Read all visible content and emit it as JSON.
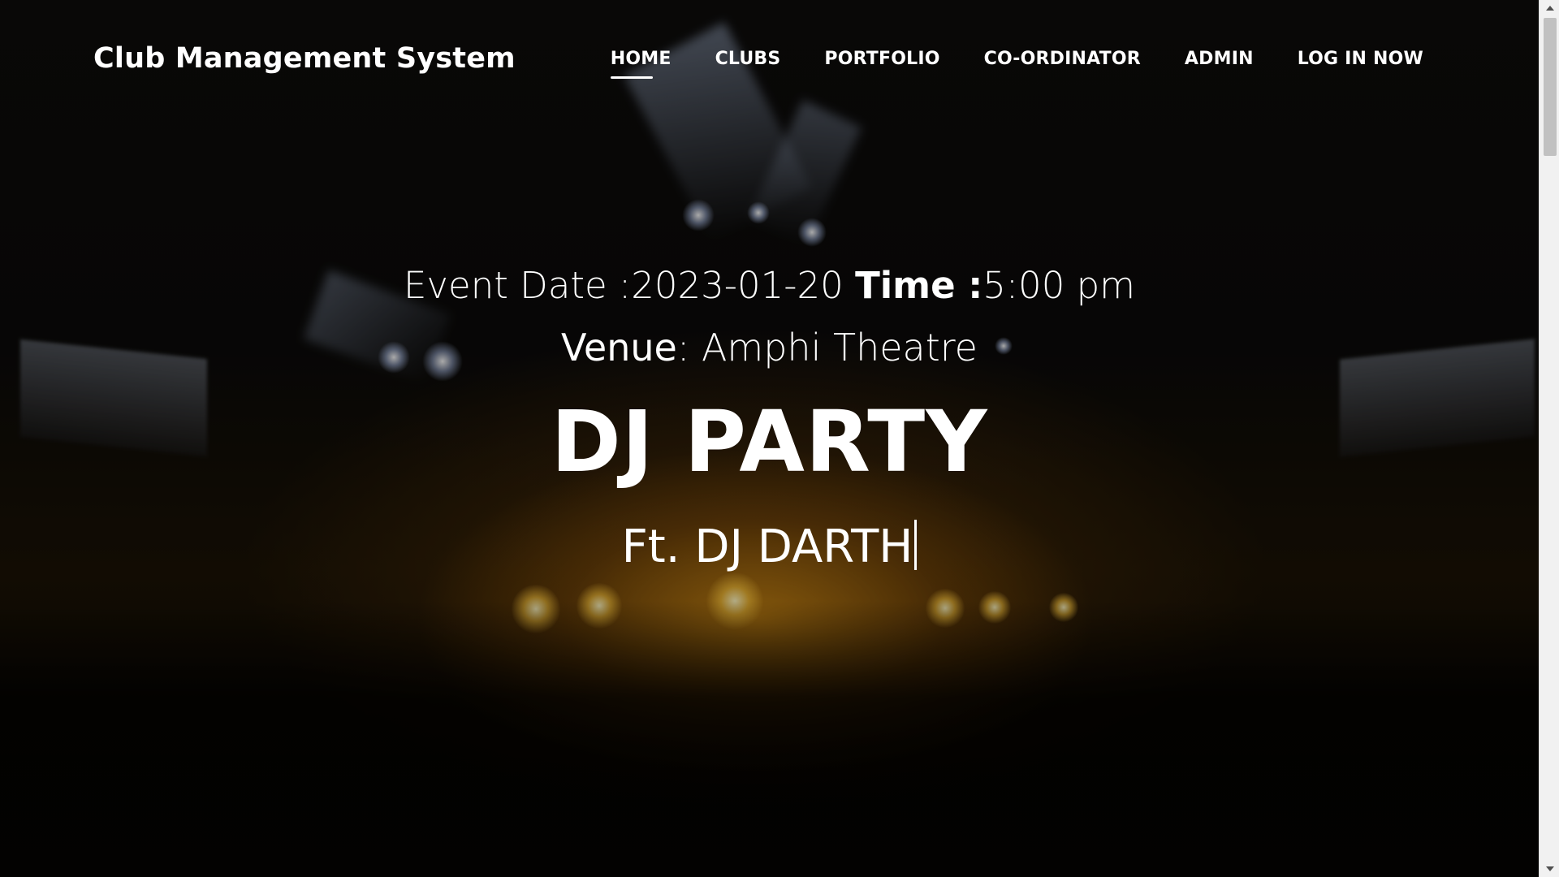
{
  "navbar": {
    "brand": "Club Management System",
    "items": [
      {
        "label": "HOME",
        "active": true
      },
      {
        "label": "CLUBS",
        "active": false
      },
      {
        "label": "PORTFOLIO",
        "active": false
      },
      {
        "label": "CO-ORDINATOR",
        "active": false
      },
      {
        "label": "ADMIN",
        "active": false
      },
      {
        "label": "LOG IN NOW",
        "active": false
      }
    ]
  },
  "hero": {
    "date_label": "Event Date :",
    "date_value": "2023-01-20",
    "time_label": "Time :",
    "time_value": "5:00 pm",
    "venue_label": "Venue",
    "venue_value": ": Amphi Theatre",
    "title": "DJ PARTY",
    "subtitle": "Ft. DJ DARTH"
  },
  "background": {
    "scene": "concert-stage-image",
    "accent_color": "#d28c14"
  },
  "scrollbar": {
    "track_color": "#f1f1f1",
    "thumb_color": "#c1c1c1"
  }
}
